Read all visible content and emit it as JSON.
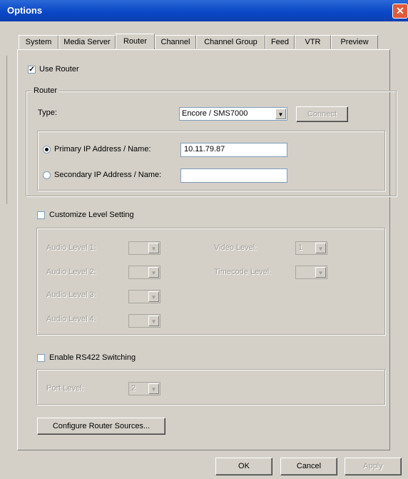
{
  "window": {
    "title": "Options",
    "close_glyph": "✕"
  },
  "tabs": [
    "System",
    "Media Server",
    "Router",
    "Channel",
    "Channel Group",
    "Feed",
    "VTR",
    "Preview"
  ],
  "active_tab": "Router",
  "use_router": {
    "label": "Use Router",
    "checked": true
  },
  "router_group": {
    "legend": "Router",
    "type_label": "Type:",
    "type_value": "Encore / SMS7000",
    "connect_label": "Connect",
    "primary_label": "Primary IP Address / Name:",
    "primary_value": "10.11.79.87",
    "primary_selected": true,
    "secondary_label": "Secondary IP Address / Name:",
    "secondary_value": ""
  },
  "customize": {
    "label": "Customize Level Setting",
    "checked": false,
    "audio1": "Audio Level 1:",
    "audio2": "Audio Level 2:",
    "audio3": "Audio Level 3:",
    "audio4": "Audio Level 4:",
    "video": "Video Level:",
    "video_value": "1",
    "timecode": "Timecode Level:"
  },
  "rs422": {
    "label": "Enable RS422 Switching",
    "checked": false,
    "port_label": "Port Level:",
    "port_value": "2"
  },
  "configure_button": "Configure Router Sources...",
  "footer": {
    "ok": "OK",
    "cancel": "Cancel",
    "apply": "Apply"
  },
  "icons": {
    "combo_arrow": "▼",
    "check": "✓"
  }
}
